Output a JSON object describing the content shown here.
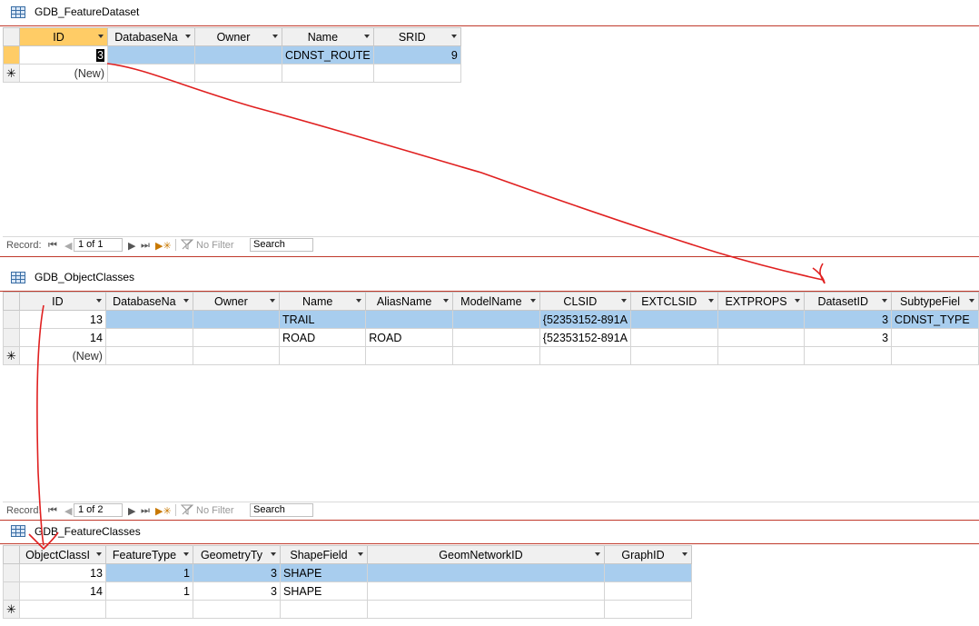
{
  "panels": [
    {
      "title": "GDB_FeatureDataset",
      "columns": [
        "ID",
        "DatabaseNa",
        "Owner",
        "Name",
        "SRID"
      ],
      "rows": [
        [
          "3",
          "",
          "",
          "CDNST_ROUTE",
          "9"
        ]
      ],
      "new_row_label": "(New)",
      "nav": {
        "record_label": "Record:",
        "position": "1 of 1",
        "filter_label": "No Filter",
        "search_label": "Search"
      }
    },
    {
      "title": "GDB_ObjectClasses",
      "columns": [
        "ID",
        "DatabaseNa",
        "Owner",
        "Name",
        "AliasName",
        "ModelName",
        "CLSID",
        "EXTCLSID",
        "EXTPROPS",
        "DatasetID",
        "SubtypeFiel"
      ],
      "rows": [
        [
          "13",
          "",
          "",
          "TRAIL",
          "",
          "",
          "{52353152-891A",
          "",
          "",
          "3",
          "CDNST_TYPE"
        ],
        [
          "14",
          "",
          "",
          "ROAD",
          "ROAD",
          "",
          "{52353152-891A",
          "",
          "",
          "3",
          ""
        ]
      ],
      "new_row_label": "(New)",
      "nav": {
        "record_label": "Record:",
        "position": "1 of 2",
        "filter_label": "No Filter",
        "search_label": "Search"
      }
    },
    {
      "title": "GDB_FeatureClasses",
      "columns": [
        "ObjectClassI",
        "FeatureType",
        "GeometryTy",
        "ShapeField",
        "GeomNetworkID",
        "GraphID"
      ],
      "rows": [
        [
          "13",
          "1",
          "3",
          "SHAPE",
          "",
          ""
        ],
        [
          "14",
          "1",
          "3",
          "SHAPE",
          "",
          ""
        ]
      ]
    }
  ],
  "colors": {
    "header_active": "#ffcc66",
    "row_highlight": "#a8cdee",
    "annotation_arrow": "#e02020",
    "title_rule": "#c0392b"
  },
  "icons": {
    "table": "table-icon",
    "first": "first-record-icon",
    "prev": "prev-record-icon",
    "next": "next-record-icon",
    "last": "last-record-icon",
    "new": "new-record-icon",
    "filter": "filter-icon",
    "new_row_marker": "asterisk-icon",
    "dropdown": "chevron-down-icon"
  }
}
